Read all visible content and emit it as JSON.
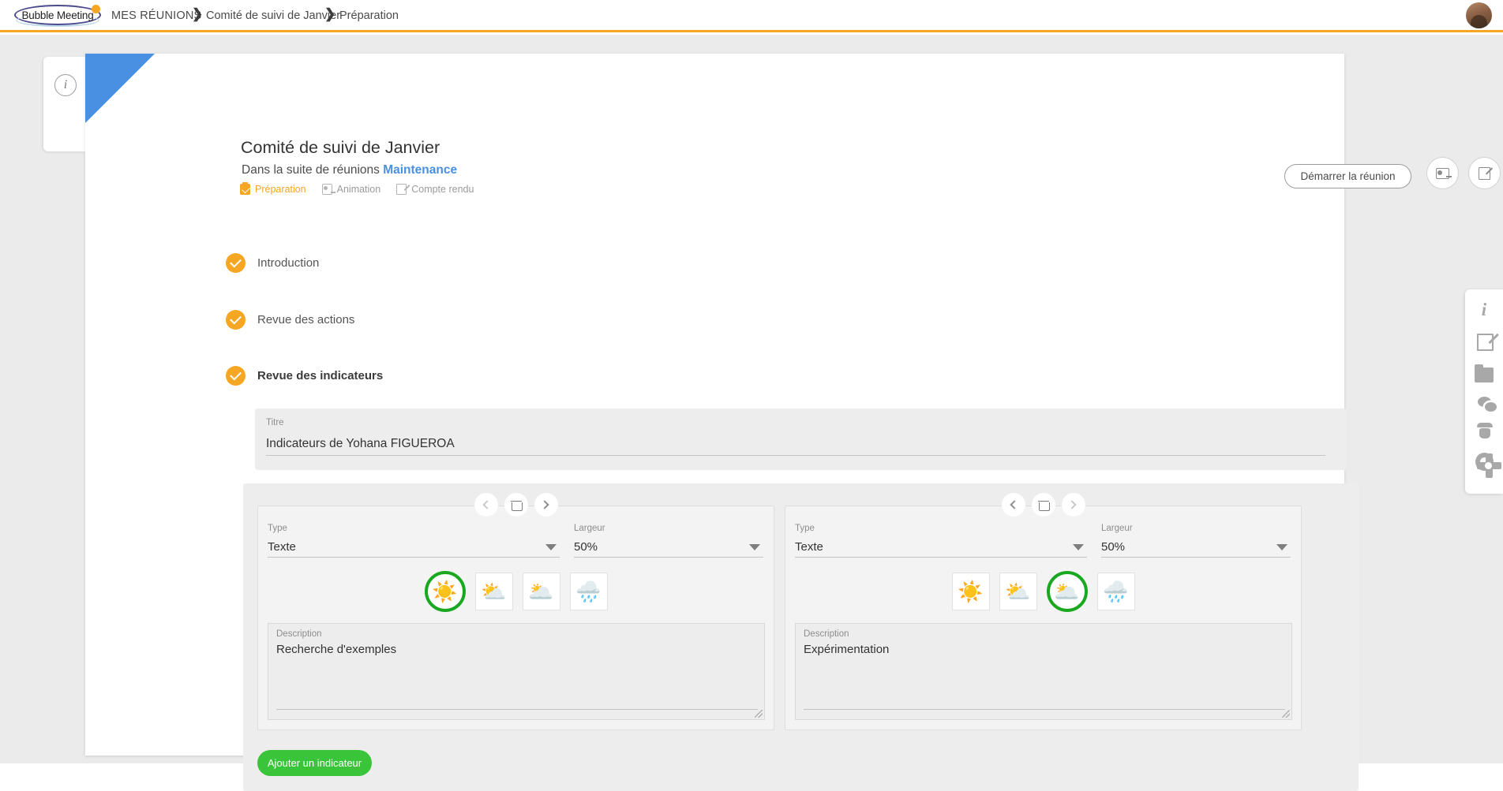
{
  "topbar": {
    "logo_text": "Bubble Meeting",
    "logo_dot": "logo-dot",
    "breadcrumb": {
      "root": "MES RÉUNIONS",
      "separator": "❯",
      "middle": "Comité de suivi de Janvier",
      "last": "Préparation"
    },
    "avatar_alt": "user-avatar"
  },
  "meeting": {
    "title": "Comité de suivi de Janvier",
    "subtitle_prefix": "Dans la suite de réunions ",
    "suite_name": "Maintenance",
    "start_button": "Démarrer la réunion",
    "tabs": [
      {
        "label": "Préparation",
        "icon": "clipboard-check-icon",
        "active": true
      },
      {
        "label": "Animation",
        "icon": "presentation-icon",
        "active": false
      },
      {
        "label": "Compte rendu",
        "icon": "report-edit-icon",
        "active": false
      }
    ]
  },
  "agenda": {
    "items": [
      {
        "label": "Introduction",
        "checked": true,
        "active": false
      },
      {
        "label": "Revue des actions",
        "checked": true,
        "active": false
      },
      {
        "label": "Revue des indicateurs",
        "checked": true,
        "active": true
      }
    ]
  },
  "titre": {
    "label": "Titre",
    "value": "Indicateurs de Yohana FIGUEROA"
  },
  "indicators": {
    "add_button": "Ajouter un indicateur",
    "field_labels": {
      "type": "Type",
      "width": "Largeur",
      "description": "Description"
    },
    "type_options": [
      "Texte"
    ],
    "width_options": [
      "50%"
    ],
    "cards": [
      {
        "type_value": "Texte",
        "width_value": "50%",
        "selected_weather": 0,
        "description_value": "Recherche d'exemples",
        "prev_enabled": false,
        "next_enabled": true
      },
      {
        "type_value": "Texte",
        "width_value": "50%",
        "selected_weather": 2,
        "description_value": "Expérimentation",
        "prev_enabled": true,
        "next_enabled": false
      }
    ],
    "weather_icons": [
      {
        "name": "sun-icon",
        "glyph": "☀️"
      },
      {
        "name": "sun-behind-cloud-icon",
        "glyph": "⛅"
      },
      {
        "name": "sun-behind-dark-cloud-icon",
        "glyph": "🌥️"
      },
      {
        "name": "cloud-with-rain-icon",
        "glyph": "🌧️"
      }
    ],
    "toolbar_icons": {
      "prev": "chevron-left-icon",
      "delete": "trash-icon",
      "next": "chevron-right-icon"
    }
  },
  "left_rail": {
    "info_icon": "info-icon"
  },
  "card_actions": [
    {
      "name": "presentation-icon"
    },
    {
      "name": "report-edit-icon"
    }
  ],
  "right_rail": {
    "items": [
      {
        "name": "info-icon"
      },
      {
        "name": "edit-document-icon"
      },
      {
        "name": "folder-icon"
      },
      {
        "name": "chat-bubbles-icon"
      },
      {
        "name": "spy-icon"
      },
      {
        "name": "gear-icon"
      }
    ]
  },
  "colors": {
    "accent_orange": "#f5a623",
    "link_blue": "#4a90e2",
    "flag_blue": "#4a90e2",
    "selected_green": "#1ba821",
    "add_button_green": "#3ac43a",
    "page_background": "#ebebeb"
  }
}
